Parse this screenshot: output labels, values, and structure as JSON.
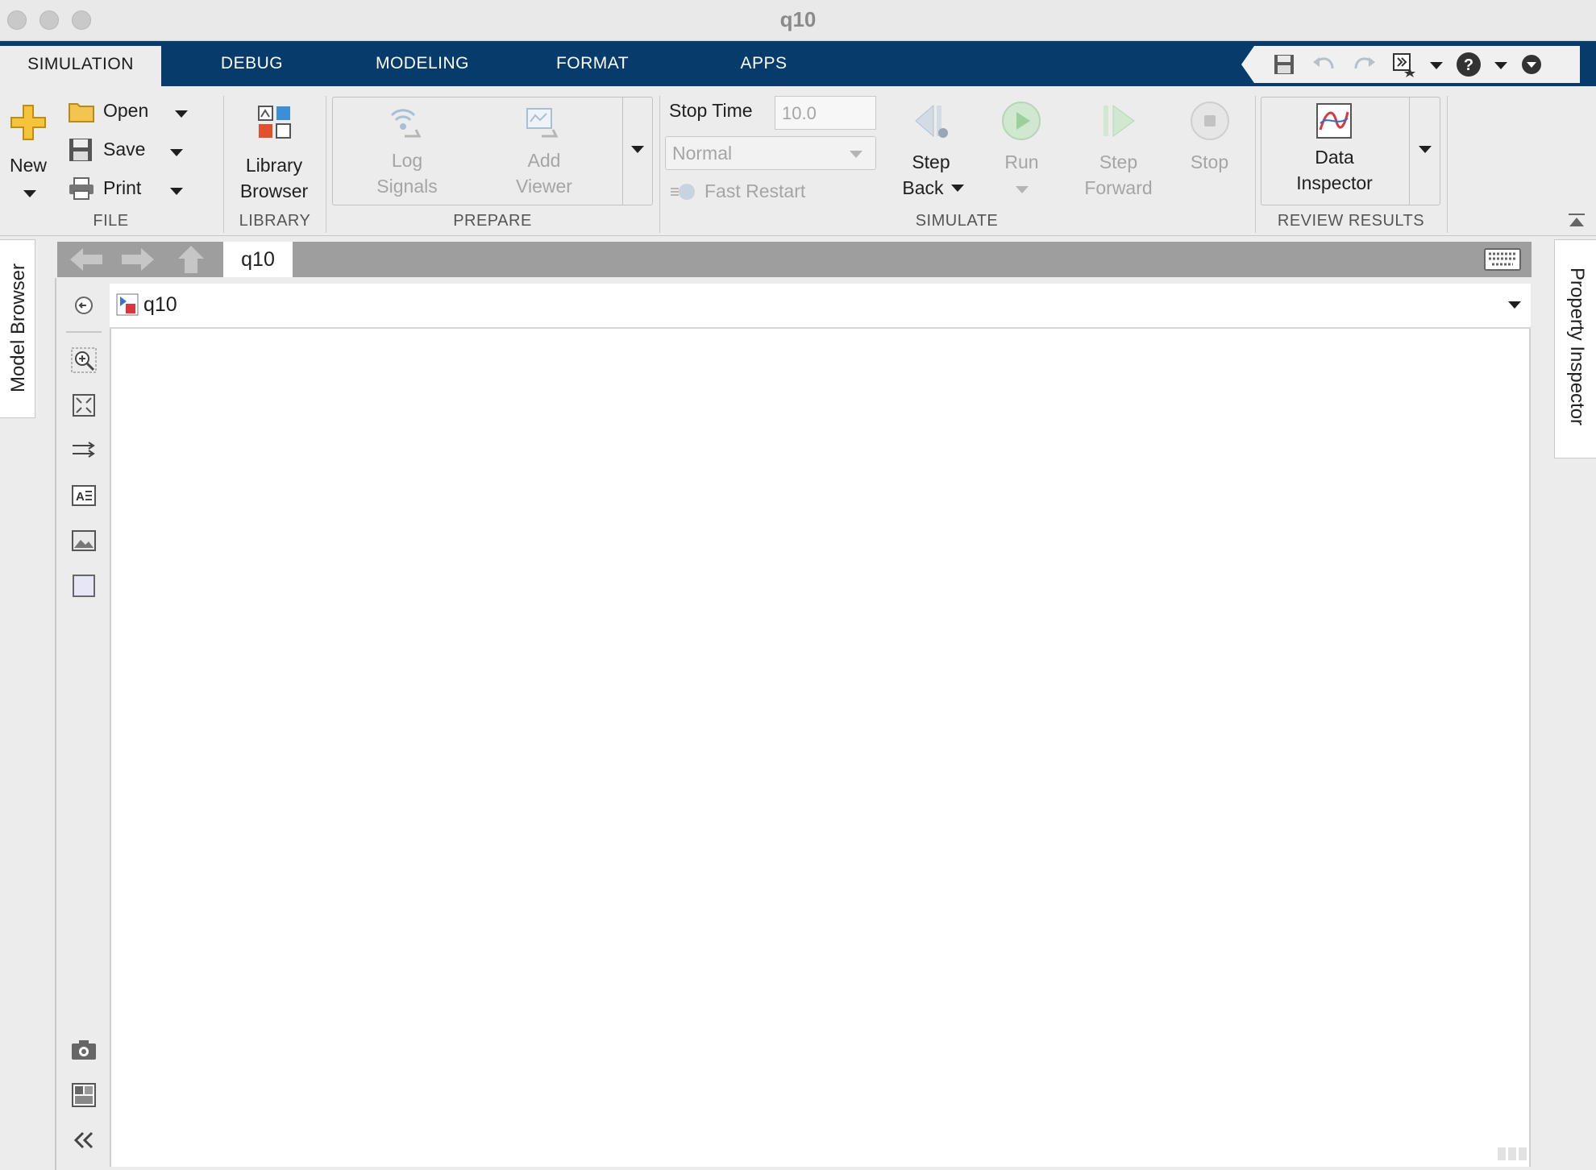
{
  "window": {
    "title": "q10"
  },
  "tabs": [
    {
      "label": "SIMULATION",
      "active": true
    },
    {
      "label": "DEBUG"
    },
    {
      "label": "MODELING"
    },
    {
      "label": "FORMAT"
    },
    {
      "label": "APPS"
    }
  ],
  "ribbon": {
    "file": {
      "section_label": "FILE",
      "new_label": "New",
      "open_label": "Open",
      "save_label": "Save",
      "print_label": "Print"
    },
    "library": {
      "section_label": "LIBRARY",
      "browser_label_1": "Library",
      "browser_label_2": "Browser"
    },
    "prepare": {
      "section_label": "PREPARE",
      "log_signals_1": "Log",
      "log_signals_2": "Signals",
      "add_viewer_1": "Add",
      "add_viewer_2": "Viewer"
    },
    "simulate": {
      "section_label": "SIMULATE",
      "stop_time_label": "Stop Time",
      "stop_time_value": "10.0",
      "mode_value": "Normal",
      "fast_restart_label": "Fast Restart",
      "step_back_1": "Step",
      "step_back_2": "Back",
      "run_label": "Run",
      "step_forward_1": "Step",
      "step_forward_2": "Forward",
      "stop_label": "Stop"
    },
    "review": {
      "section_label": "REVIEW RESULTS",
      "data_inspector_1": "Data",
      "data_inspector_2": "Inspector"
    }
  },
  "side_tabs": {
    "left": "Model Browser",
    "right": "Property Inspector"
  },
  "editor": {
    "breadcrumb_tab": "q10",
    "address_model": "q10"
  },
  "colors": {
    "tab_strip": "#073b6c",
    "ribbon_bg": "#ececec",
    "canvas_bg": "#ffffff"
  }
}
